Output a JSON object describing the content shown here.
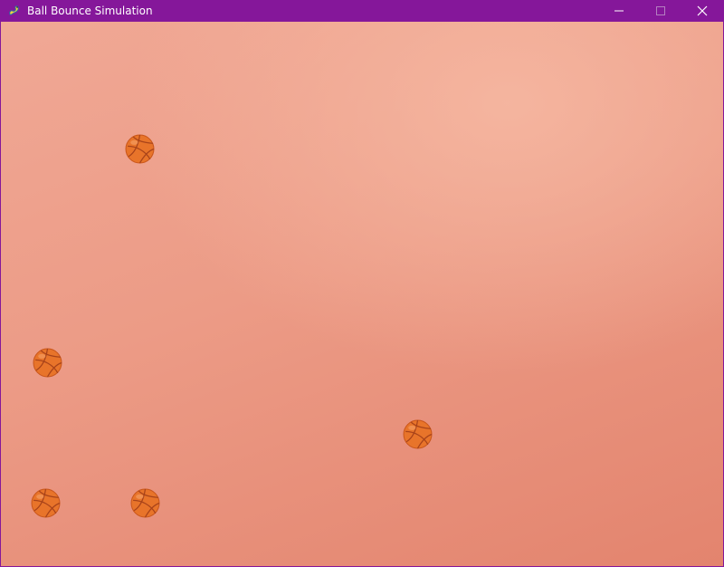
{
  "window": {
    "title": "Ball Bounce Simulation",
    "app_icon": "pygame-snake-icon",
    "titlebar_color": "#85179a",
    "controls": [
      {
        "name": "minimize-icon"
      },
      {
        "name": "maximize-icon"
      },
      {
        "name": "close-icon"
      }
    ]
  },
  "scene": {
    "background_color": "#ec9b86",
    "ball_icon": "basketball-icon",
    "ball_color": "#e8742a"
  }
}
